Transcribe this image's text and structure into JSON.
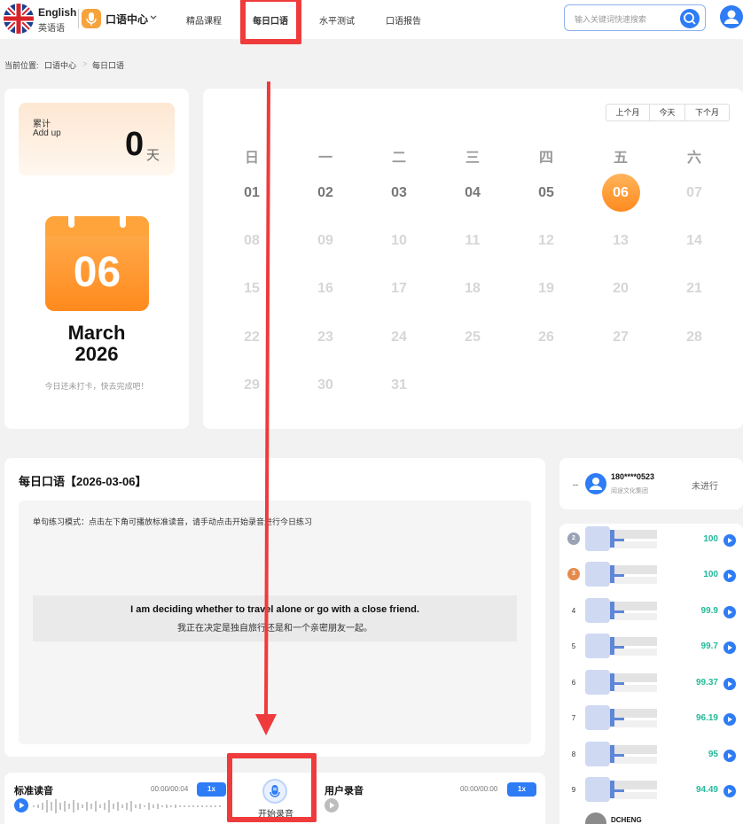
{
  "header": {
    "lang_en": "English",
    "lang_cn": "英语语",
    "center_name": "口语中心",
    "nav": [
      "精品课程",
      "每日口语",
      "水平测试",
      "口语报告"
    ],
    "active_nav": "每日口语",
    "search_placeholder": "输入关键词快速搜索"
  },
  "breadcrumb": {
    "prefix": "当前位置:",
    "parent": "口语中心",
    "sep": ">",
    "current": "每日口语"
  },
  "summary": {
    "addup_cn": "累计",
    "addup_en": "Add up",
    "count": "0",
    "unit": "天",
    "calendar_day": "06",
    "month": "March",
    "year": "2026",
    "hint": "今日还未打卡，快去完成吧！"
  },
  "calendar": {
    "buttons": [
      "上个月",
      "今天",
      "下个月"
    ],
    "weekdays": [
      "日",
      "一",
      "二",
      "三",
      "四",
      "五",
      "六"
    ],
    "weeks": [
      [
        "01",
        "02",
        "03",
        "04",
        "05",
        "06",
        "07"
      ],
      [
        "08",
        "09",
        "10",
        "11",
        "12",
        "13",
        "14"
      ],
      [
        "15",
        "16",
        "17",
        "18",
        "19",
        "20",
        "21"
      ],
      [
        "22",
        "23",
        "24",
        "25",
        "26",
        "27",
        "28"
      ],
      [
        "29",
        "30",
        "31"
      ]
    ],
    "today": "06"
  },
  "daily": {
    "title": "每日口语【2026-03-06】",
    "mode_text": "单句练习模式：点击左下角可播放标准读音，请手动点击开始录音进行今日练习",
    "sentence_en": "I am deciding whether to travel alone or go with a close friend.",
    "sentence_cn": "我正在决定是独自旅行还是和一个亲密朋友一起。"
  },
  "audio": {
    "standard_label": "标准读音",
    "standard_time": "00:00/00:04",
    "user_label": "用户录音",
    "user_time": "00:00/00:00",
    "speed": "1x",
    "record_label": "开始录音"
  },
  "status": {
    "rank": "--",
    "user": "180****0523",
    "org": "阅途文化集团",
    "state": "未进行"
  },
  "ranking": [
    {
      "rank": "2",
      "score": "100",
      "medal": "silver"
    },
    {
      "rank": "3",
      "score": "100",
      "medal": "bronze"
    },
    {
      "rank": "4",
      "score": "99.9"
    },
    {
      "rank": "5",
      "score": "99.7"
    },
    {
      "rank": "6",
      "score": "99.37"
    },
    {
      "rank": "7",
      "score": "96.19"
    },
    {
      "rank": "8",
      "score": "95"
    },
    {
      "rank": "9",
      "score": "94.49"
    }
  ],
  "ranking_partial_name": "DCHENG",
  "colors": {
    "primary": "#2e7cf6",
    "orange": "#ff8a1e",
    "score_green": "#23b99a",
    "highlight_red": "#ef3b3b"
  }
}
